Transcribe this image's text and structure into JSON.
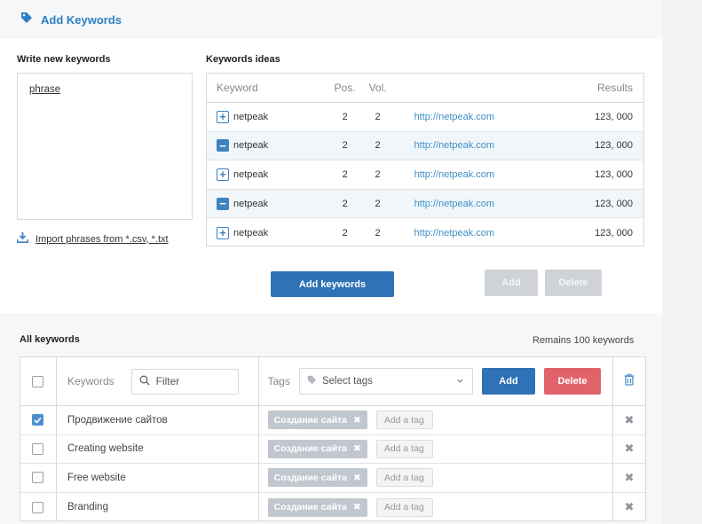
{
  "header": {
    "title": "Add Keywords",
    "icon": "tag-icon"
  },
  "new_keywords": {
    "label": "Write new keywords",
    "value": "phrase",
    "import_link": "Import phrases from *.csv, *.txt"
  },
  "ideas": {
    "label": "Keywords ideas",
    "columns": {
      "keyword": "Keyword",
      "pos": "Pos.",
      "vol": "Vol.",
      "results": "Results"
    },
    "rows": [
      {
        "state": "plus",
        "keyword": "netpeak",
        "pos": "2",
        "vol": "2",
        "url": "http://netpeak.com",
        "results": "123, 000"
      },
      {
        "state": "minus",
        "keyword": "netpeak",
        "pos": "2",
        "vol": "2",
        "url": "http://netpeak.com",
        "results": "123, 000"
      },
      {
        "state": "plus",
        "keyword": "netpeak",
        "pos": "2",
        "vol": "2",
        "url": "http://netpeak.com",
        "results": "123, 000"
      },
      {
        "state": "minus",
        "keyword": "netpeak",
        "pos": "2",
        "vol": "2",
        "url": "http://netpeak.com",
        "results": "123, 000"
      },
      {
        "state": "plus",
        "keyword": "netpeak",
        "pos": "2",
        "vol": "2",
        "url": "http://netpeak.com",
        "results": "123, 000"
      }
    ]
  },
  "actions": {
    "add_keywords": "Add keywords",
    "add": "Add",
    "delete": "Delete"
  },
  "all_keywords": {
    "label": "All keywords",
    "remains": "Remains 100 keywords",
    "head": {
      "keywords": "Keywords",
      "filter_placeholder": "Filter",
      "tags": "Tags",
      "select_placeholder": "Select tags",
      "add": "Add",
      "delete": "Delete"
    },
    "rows": [
      {
        "checked": true,
        "keyword": "Продвижение сайтов",
        "tag": "Создание сайта",
        "add_tag": "Add a tag"
      },
      {
        "checked": false,
        "keyword": "Creating website",
        "tag": "Создание сайта",
        "add_tag": "Add a tag"
      },
      {
        "checked": false,
        "keyword": "Free website",
        "tag": "Создание сайта",
        "add_tag": "Add a tag"
      },
      {
        "checked": false,
        "keyword": "Branding",
        "tag": "Создание сайта",
        "add_tag": "Add a tag"
      }
    ]
  },
  "colors": {
    "accent": "#2f72b5",
    "link": "#3d8fc7",
    "danger": "#e0626a",
    "disabled": "#cfd2d6",
    "tag": "#c1c7cf"
  }
}
